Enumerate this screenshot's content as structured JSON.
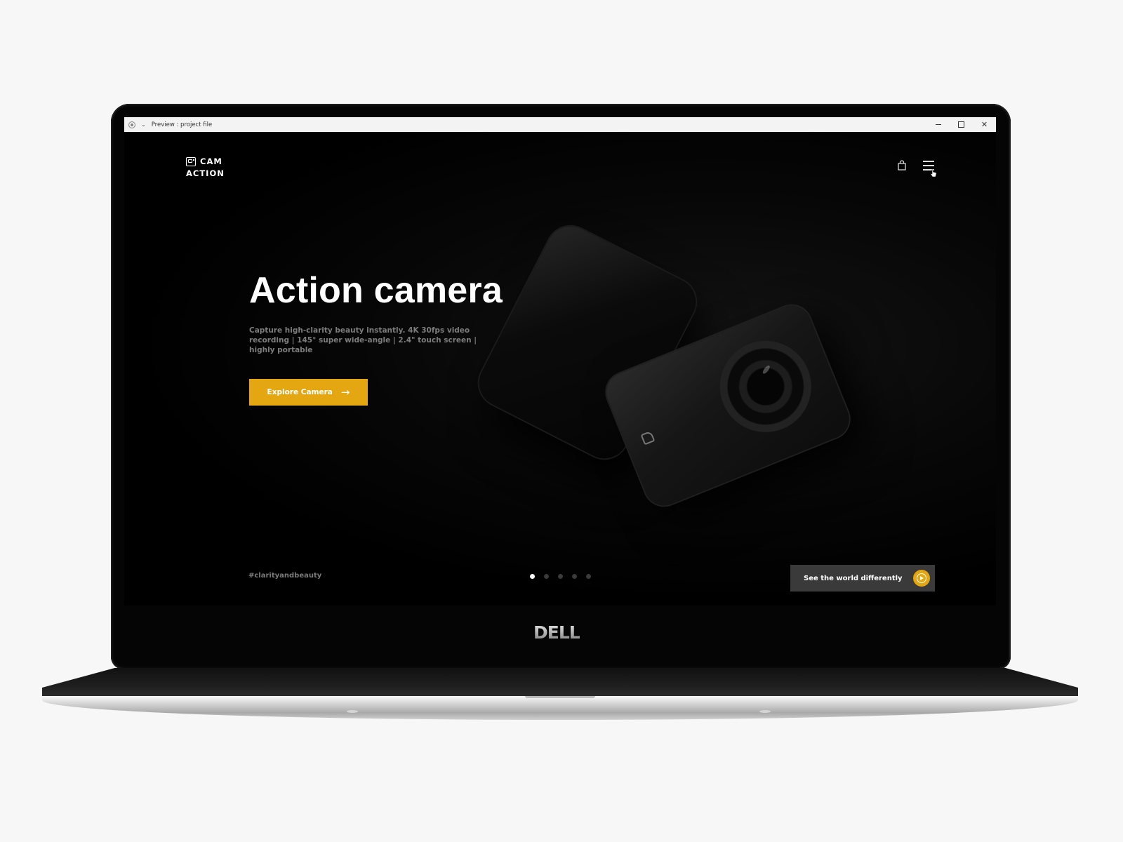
{
  "window": {
    "title": "Preview : project file",
    "controls": [
      "minimize-icon",
      "maximize-icon",
      "close-icon"
    ]
  },
  "site": {
    "logo": {
      "line1": "CAM",
      "line2": "ACTION",
      "icon": "camera-icon"
    },
    "nav": {
      "cart_icon": "shopping-bag-icon",
      "menu_icon": "hamburger-menu-icon"
    },
    "hero": {
      "title": "Action camera",
      "description": "Capture high-clarity beauty instantly. 4K 30fps video recording | 145° super wide-angle | 2.4\" touch screen | highly portable",
      "cta_label": "Explore Camera",
      "cta_icon": "arrow-right-icon"
    },
    "footer": {
      "hashtag": "#clarityandbeauty",
      "slides": {
        "count": 5,
        "active": 1
      },
      "video_button_label": "See the world differently",
      "video_button_icon": "play-circle-icon"
    },
    "colors": {
      "accent": "#e4a611",
      "background": "#000000",
      "button_dark": "#3a3a3a"
    }
  },
  "device": {
    "brand": "DELL"
  }
}
